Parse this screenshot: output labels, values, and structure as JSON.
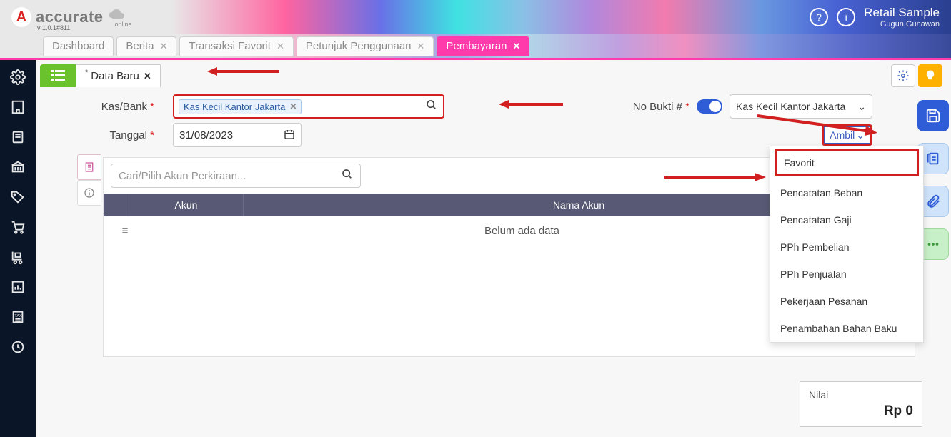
{
  "header": {
    "logo_letter": "A",
    "logo_text": "accurate",
    "logo_sub": "online",
    "version": "v 1.0.1#811",
    "company": "Retail Sample",
    "user": "Gugun Gunawan"
  },
  "tabs": [
    {
      "label": "Dashboard",
      "closable": false,
      "active": false
    },
    {
      "label": "Berita",
      "closable": true,
      "active": false
    },
    {
      "label": "Transaksi Favorit",
      "closable": true,
      "active": false
    },
    {
      "label": "Petunjuk Penggunaan",
      "closable": true,
      "active": false
    },
    {
      "label": "Pembayaran",
      "closable": true,
      "active": true
    }
  ],
  "subtab": {
    "title": "Data Baru"
  },
  "form": {
    "kasbank_label": "Kas/Bank",
    "kasbank_value": "Kas Kecil Kantor Jakarta",
    "tanggal_label": "Tanggal",
    "tanggal_value": "31/08/2023",
    "nobukti_label": "No Bukti #",
    "select_value": "Kas Kecil Kantor Jakarta",
    "ambil_label": "Ambil"
  },
  "dropdown_items": [
    "Favorit",
    "Pencatatan Beban",
    "Pencatatan Gaji",
    "PPh Pembelian",
    "PPh Penjualan",
    "Pekerjaan Pesanan",
    "Penambahan Bahan Baku"
  ],
  "search_akun_placeholder": "Cari/Pilih Akun Perkiraan...",
  "table": {
    "headers": {
      "akun": "Akun",
      "nama": "Nama Akun"
    },
    "empty": "Belum ada data"
  },
  "summary": {
    "label": "Nilai",
    "value": "Rp 0"
  }
}
